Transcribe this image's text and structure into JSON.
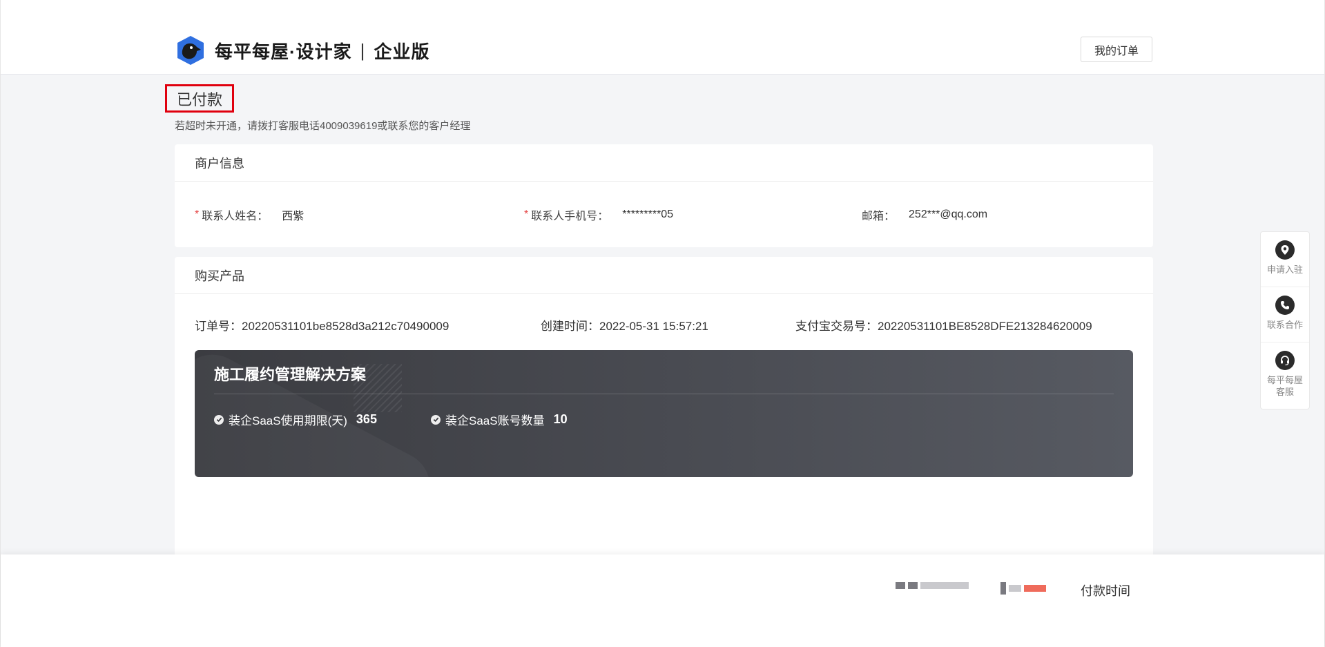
{
  "header": {
    "logo_name": "每平每屋·设计家",
    "logo_separator": "|",
    "logo_edition": "企业版",
    "my_orders_label": "我的订单"
  },
  "status": {
    "title": "已付款",
    "note": "若超时未开通，请拨打客服电话4009039619或联系您的客户经理"
  },
  "merchant": {
    "section_title": "商户信息",
    "contact_name_label": "联系人姓名：",
    "contact_name_value": "西紫",
    "phone_label": "联系人手机号：",
    "phone_value": "*********05",
    "email_label": "邮箱：",
    "email_value": "252***@qq.com",
    "required_mark": "*"
  },
  "product": {
    "section_title": "购买产品",
    "order_no_label": "订单号：",
    "order_no_value": "20220531101be8528d3a212c70490009",
    "created_label": "创建时间：",
    "created_value": "2022-05-31 15:57:21",
    "alipay_label": "支付宝交易号：",
    "alipay_value": "20220531101BE8528DFE213284620009",
    "plan": {
      "title": "施工履约管理解决方案",
      "features": [
        {
          "label": "装企SaaS使用期限(天)",
          "value": "365"
        },
        {
          "label": "装企SaaS账号数量",
          "value": "10"
        }
      ]
    }
  },
  "sidebar": {
    "items": [
      {
        "label": "申请入驻",
        "icon": "location-pin-icon"
      },
      {
        "label": "联系合作",
        "icon": "phone-icon"
      },
      {
        "label": "每平每屋客服",
        "icon": "headset-icon"
      }
    ]
  },
  "footer": {
    "pay_time_label": "付款时间"
  },
  "colors": {
    "highlight_border": "#e0000e",
    "required_star": "#e54545",
    "plan_background": "#3b3c41"
  }
}
